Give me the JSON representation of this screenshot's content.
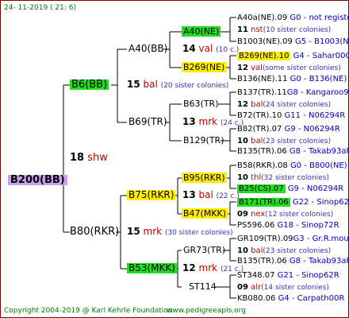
{
  "date": "24- 11-2019 ( 21: 6)",
  "root": {
    "name": "B200(BB)"
  },
  "gen1": [
    {
      "name": "B6(BB)",
      "num": "18",
      "code": "shw"
    },
    {
      "name": "B80(RKR)",
      "num": "15",
      "code": "mrk",
      "note": "(30 sister colonies)"
    }
  ],
  "gen2": [
    {
      "name": "A40(BB)",
      "num": "14",
      "code": "val",
      "note": "(10 c.)"
    },
    {
      "name": "B69(TR)",
      "num": "13",
      "code": "mrk",
      "note": "(24 c.)"
    },
    {
      "name": "B75(RKR)",
      "num": "13",
      "code": "bal",
      "note": "(22 c.)"
    },
    {
      "name": "B53(MKK)",
      "num": "12",
      "code": "mrk",
      "note": "(21 c.)"
    }
  ],
  "gen2_extra": [
    {
      "num": "15",
      "code": "bal",
      "note": "(20 sister colonies)"
    }
  ],
  "gen3": [
    {
      "name": "A40(NE)"
    },
    {
      "name": "B269(NE)"
    },
    {
      "name": "B63(TR)"
    },
    {
      "name": "B129(TR)"
    },
    {
      "name": "B95(RKR)"
    },
    {
      "name": "B47(MKK)"
    },
    {
      "name": "GR73(TR)"
    },
    {
      "name": "ST114"
    }
  ],
  "gen4": [
    {
      "name": "A40a(NE).09",
      "gen": "G0 - not registe"
    },
    {
      "num": "11",
      "code": "nst",
      "note": "(10 sister colonies)"
    },
    {
      "name": "B1003(NE).09",
      "gen": "G5 - B1003(NE)"
    },
    {
      "name": "B269(NE).10",
      "gen": "G4 - Sahar00Q"
    },
    {
      "num": "12",
      "code": "val",
      "note": "(some sister colonies)"
    },
    {
      "name": "B136(NE).11",
      "gen": "G0 - B136(NE)"
    },
    {
      "name": "B137(TR).11",
      "gen": "G8 - Kangaroo98R"
    },
    {
      "num": "12",
      "code": "bal",
      "note": "(24 sister colonies)"
    },
    {
      "name": "B72(TR).10",
      "gen": "G11 - N06294R"
    },
    {
      "name": "B82(TR).07",
      "gen": "G9 - N06294R"
    },
    {
      "num": "10",
      "code": "bal",
      "note": "(23 sister colonies)"
    },
    {
      "name": "B135(TR).06",
      "gen": "G8 - Takab93aR"
    },
    {
      "name": "B58(RKR).08",
      "gen": "G0 - B800(NE)"
    },
    {
      "num": "10",
      "code": "thl",
      "note": "(32 sister colonies)"
    },
    {
      "name": "B25(CS).07",
      "gen": "G9 - N06294R"
    },
    {
      "name": "B171(TR).06",
      "gen": "G22 - Sinop62R"
    },
    {
      "num": "09",
      "code": "nex",
      "note": "(12 sister colonies)"
    },
    {
      "name": "PS596.06",
      "gen": "G18 - Sinop72R"
    },
    {
      "name": "GR109(TR).09",
      "gen": "G3 - Gr.R.mounta"
    },
    {
      "num": "10",
      "code": "bal",
      "note": "(23 sister colonies)"
    },
    {
      "name": "B135(TR).06",
      "gen": "G8 - Takab93aR"
    },
    {
      "name": "ST348.07",
      "gen": "G21 - Sinop62R"
    },
    {
      "num": "09",
      "code": "alr",
      "note": "(14 sister colonies)"
    },
    {
      "name": "KB080.06",
      "gen": "G4 - Carpath00R"
    }
  ],
  "footer": {
    "copyright": "Copyright 2004-2019 @ Karl Kehrle Foundation",
    "site": "www.pedigreeapis.org"
  }
}
